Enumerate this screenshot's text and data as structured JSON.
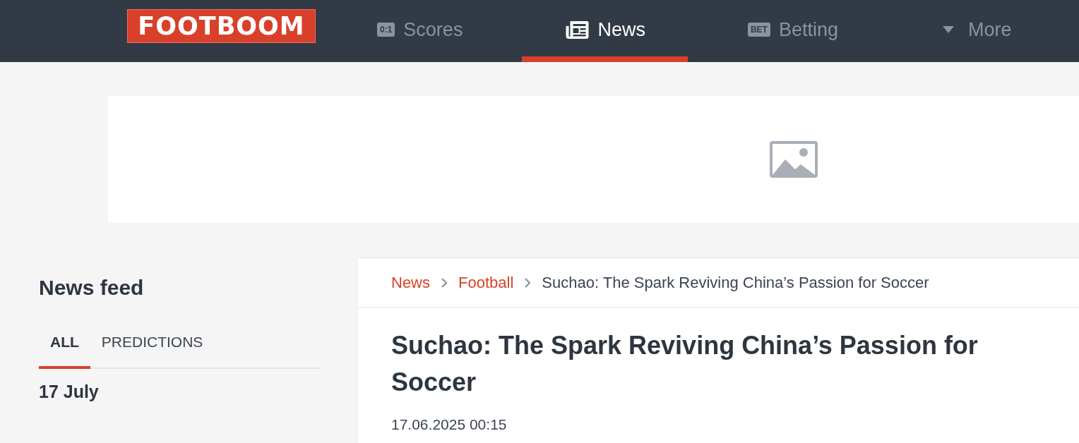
{
  "header": {
    "logo": "FOOTBOOM",
    "nav": [
      {
        "kind": "badge",
        "badge": "0:1",
        "label": "Scores",
        "selected": false
      },
      {
        "kind": "newspaper",
        "label": "News",
        "selected": true
      },
      {
        "kind": "badge",
        "badge": "BET",
        "label": "Betting",
        "selected": false
      },
      {
        "kind": "caret",
        "label": "More",
        "selected": false
      }
    ]
  },
  "sidebar": {
    "title": "News feed",
    "tabs": [
      {
        "label": "ALL",
        "selected": true
      },
      {
        "label": "PREDICTIONS",
        "selected": false
      }
    ],
    "date": "17 July"
  },
  "article": {
    "breadcrumbs": [
      {
        "label": "News",
        "link": true
      },
      {
        "label": "Football",
        "link": true
      },
      {
        "label": "Suchao: The Spark Reviving China’s Passion for Soccer",
        "link": false
      }
    ],
    "title": "Suchao: The Spark Reviving China’s Passion for Soccer",
    "date": "17.06.2025 00:15"
  }
}
